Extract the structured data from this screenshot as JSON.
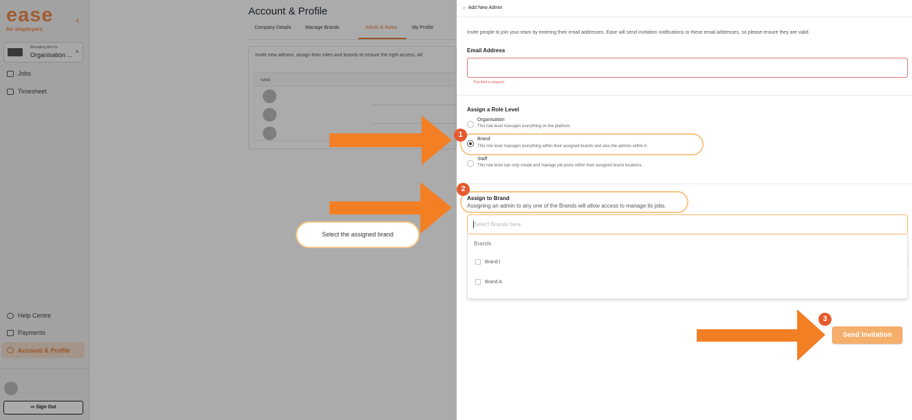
{
  "sidebar": {
    "logo": "ease",
    "logo_sub": "for employers",
    "org_label": "Managing jobs for:",
    "org_name": "Organisation ...",
    "nav": {
      "jobs": "Jobs",
      "timesheet": "Timesheet",
      "help": "Help Centre",
      "payments": "Payments",
      "account": "Account & Profile"
    },
    "sign_out": "Sign Out"
  },
  "main": {
    "title": "Account & Profile",
    "tabs": [
      "Company Details",
      "Manage Brands",
      "Admin & Roles",
      "My Profile"
    ],
    "active_tab": "Admin & Roles",
    "intro": "Invite new admins, assign their roles and brands to ensure the right access. All",
    "table_header": "NAME"
  },
  "panel": {
    "header": "Add New Admin",
    "intro": "Invite people to join your team by entering their email addresses. Ease will send invitation notifications to these email addresses, so please ensure they are valid.",
    "email_label": "Email Address",
    "email_value": "",
    "email_error": "This field is required",
    "role_label": "Assign a Role Level",
    "roles": [
      {
        "title": "Organisation",
        "desc": "This role level manages everything on the platform.",
        "selected": false
      },
      {
        "title": "Brand",
        "desc": "This role level manages everything within their assigned brands and also the admins within it.",
        "selected": true
      },
      {
        "title": "Staff",
        "desc": "This role level can only create and manage job posts within their assigned brand locations.",
        "selected": false
      }
    ],
    "assign_label": "Assign to Brand",
    "assign_desc": "Assigning an admin to any one of the Brands will allow access to manage its jobs.",
    "brand_placeholder": "Select Brands here",
    "brands_heading": "Brands",
    "brands": [
      {
        "name": "Brand I",
        "checked": false
      },
      {
        "name": "Brand A",
        "checked": false
      }
    ],
    "send_button": "Send Invitation"
  },
  "annotations": {
    "badges": [
      "1",
      "2",
      "3"
    ],
    "callout": "Select the assigned brand"
  },
  "colors": {
    "accent": "#e57d37",
    "arrow": "#f37f25",
    "badge": "#e55a2e",
    "highlight_border": "#f6c587",
    "button": "#f6ae6b",
    "error": "#e0564f"
  },
  "icons": {
    "back": "arrow-left-icon",
    "collapse": "chevron-left-icon",
    "jobs": "briefcase-icon",
    "timesheet": "calendar-icon",
    "help": "help-circle-icon",
    "payments": "card-icon",
    "account": "gear-icon",
    "sign_out": "sign-out-icon"
  }
}
